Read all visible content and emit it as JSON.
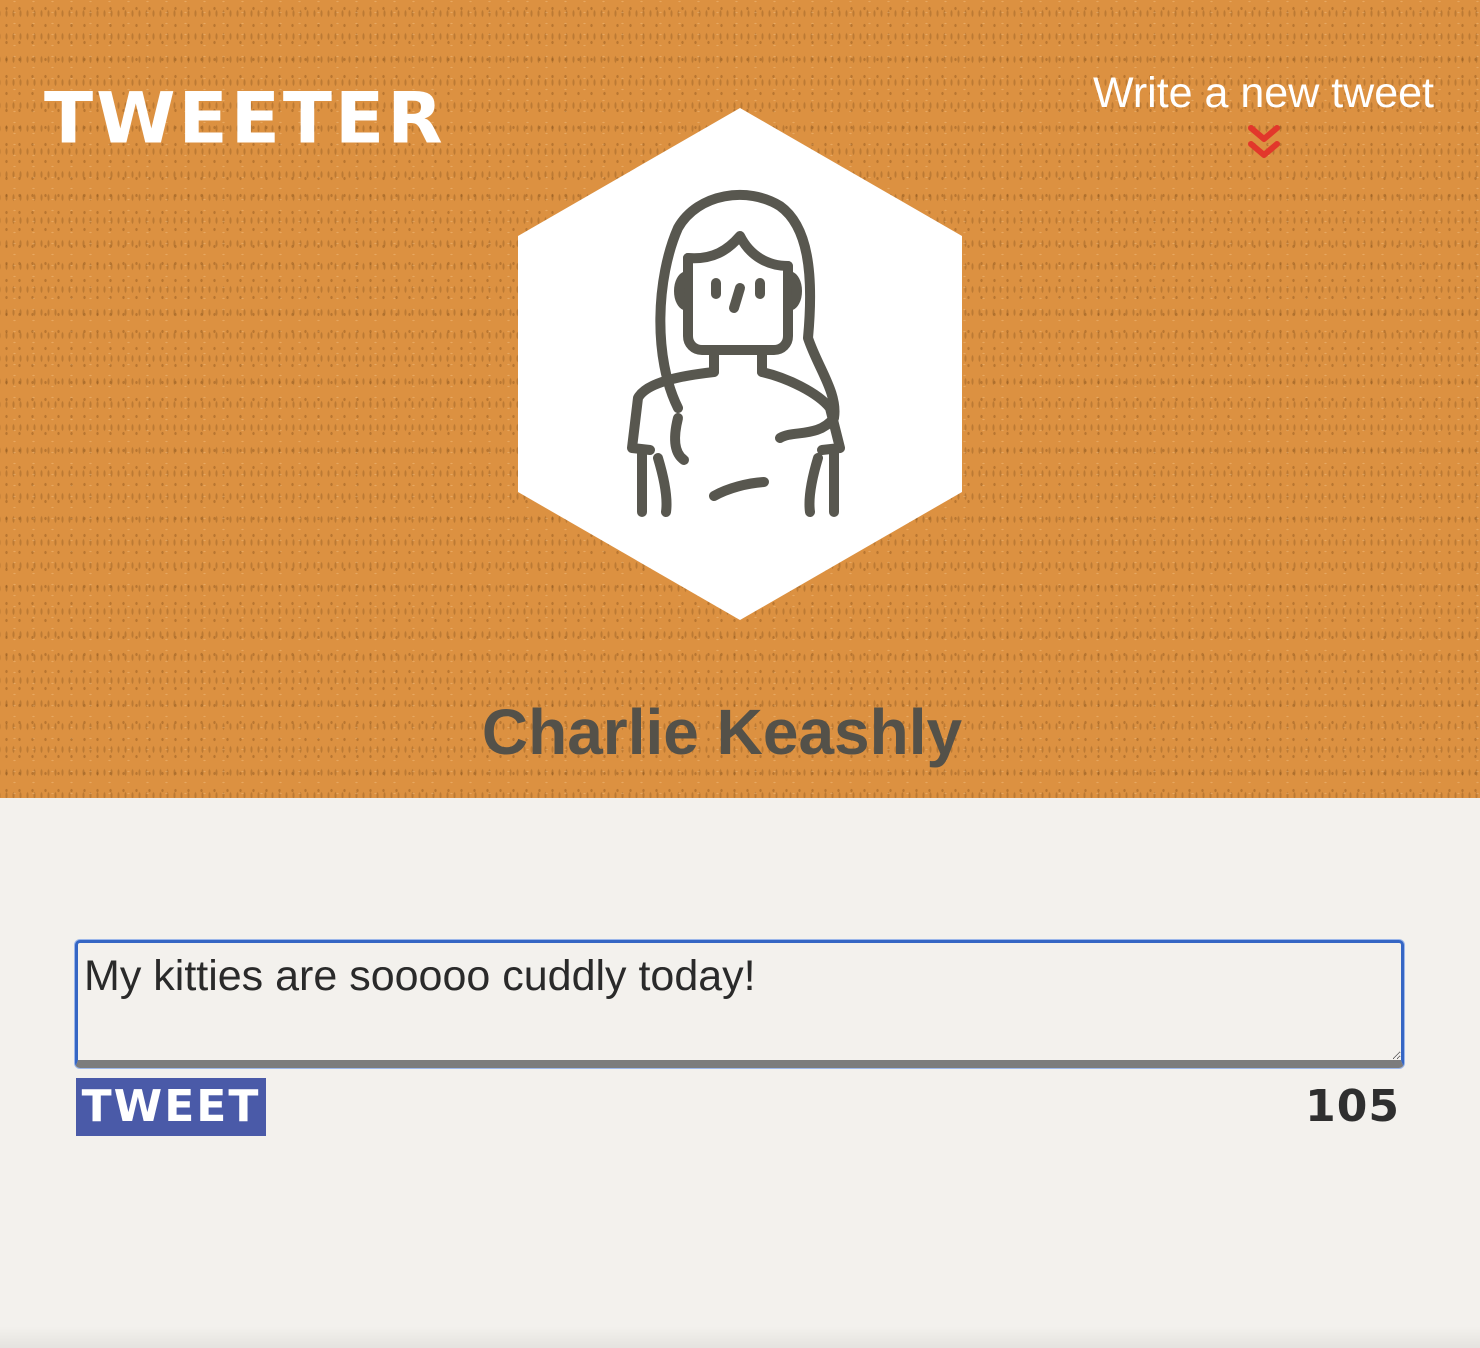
{
  "nav": {
    "brand": "TWEETER",
    "compose_label": "Write a new tweet",
    "compose_icon": "double-chevron-down-icon"
  },
  "profile": {
    "name": "Charlie Keashly",
    "avatar_icon": "user-avatar-icon"
  },
  "composer": {
    "text": "My kitties are sooooo cuddly today!",
    "submit_label": "TWEET",
    "chars_remaining": "105"
  },
  "colors": {
    "header_bg": "#dc9141",
    "page_bg": "#f3f1ed",
    "button_bg": "#4a5aa8",
    "chevron": "#e2372b",
    "name_text": "#545149"
  }
}
